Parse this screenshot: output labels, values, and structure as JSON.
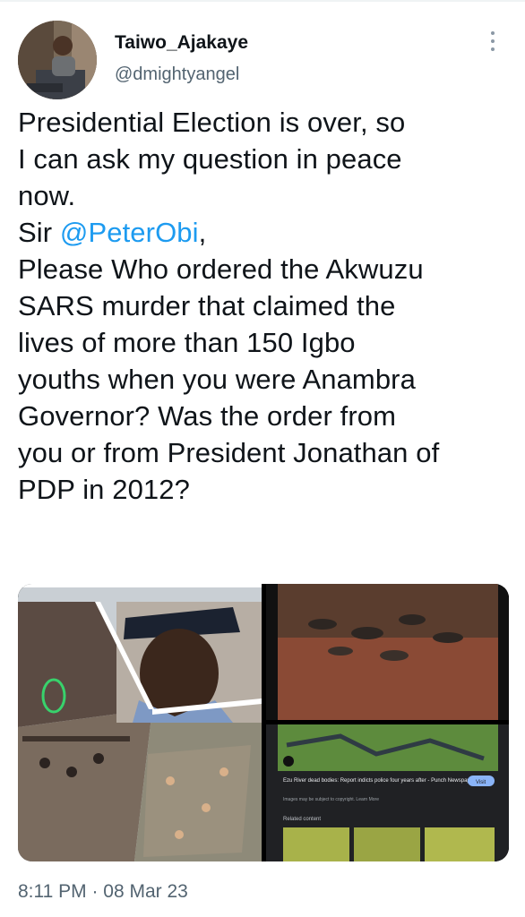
{
  "user": {
    "display_name": "Taiwo_Ajakaye",
    "handle": "@dmightyangel"
  },
  "tweet": {
    "lines": [
      "Presidential Election is over, so",
      "I can ask my question in peace",
      "now.",
      "Sir ",
      "Please Who ordered the Akwuzu",
      "SARS murder that claimed the",
      "lives of more than 150 Igbo",
      "youths when you were Anambra",
      "Governor? Was the order from",
      "you or from President Jonathan of",
      "PDP in 2012?"
    ],
    "mention": "@PeterObi",
    "mention_suffix": ","
  },
  "media": {
    "news_caption": "Ezu River dead bodies: Report indicts police four years after - Punch Newspapers",
    "news_subcaption": "Images may be subject to copyright. Learn More",
    "visit_label": "Visit",
    "related_label": "Related content"
  },
  "timestamp": "8:11 PM · 08 Mar 23",
  "colors": {
    "mention": "#1d9bf0",
    "secondary_text": "#536471"
  }
}
